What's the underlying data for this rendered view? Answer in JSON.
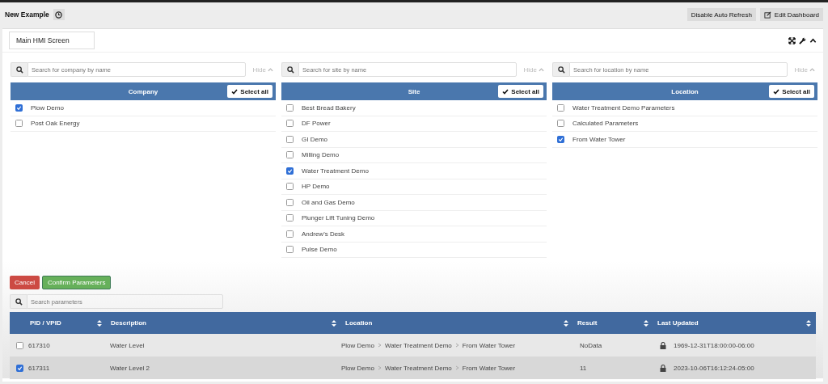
{
  "header": {
    "title": "New Example",
    "buttons": [
      "Disable Auto Refresh",
      "Edit Dashboard"
    ]
  },
  "panel": {
    "title": "Main HMI Screen"
  },
  "selectors": [
    {
      "search_placeholder": "Search for company by name",
      "hide": "Hide",
      "heading": "Company",
      "select_all": "Select all",
      "items": [
        {
          "label": "Plow Demo",
          "checked": true
        },
        {
          "label": "Post Oak Energy",
          "checked": false
        }
      ]
    },
    {
      "search_placeholder": "Search for site by name",
      "hide": "Hide",
      "heading": "Site",
      "select_all": "Select all",
      "items": [
        {
          "label": "Best Bread Bakery",
          "checked": false
        },
        {
          "label": "DF Power",
          "checked": false
        },
        {
          "label": "GI Demo",
          "checked": false
        },
        {
          "label": "Milling Demo",
          "checked": false
        },
        {
          "label": "Water Treatment Demo",
          "checked": true
        },
        {
          "label": "HP Demo",
          "checked": false
        },
        {
          "label": "Oil and Gas Demo",
          "checked": false
        },
        {
          "label": "Plunger Lift Tuning Demo",
          "checked": false
        },
        {
          "label": "Andrew's Desk",
          "checked": false
        },
        {
          "label": "Pulse Demo",
          "checked": false
        }
      ]
    },
    {
      "search_placeholder": "Search for location by name",
      "hide": "Hide",
      "heading": "Location",
      "select_all": "Select all",
      "items": [
        {
          "label": "Water Treatment Demo Parameters",
          "checked": false
        },
        {
          "label": "Calculated Parameters",
          "checked": false
        },
        {
          "label": "From Water Tower",
          "checked": true
        }
      ]
    }
  ],
  "actions": {
    "cancel": "Cancel",
    "confirm": "Confirm Parameters"
  },
  "parameter_search": {
    "placeholder": "Search parameters"
  },
  "table": {
    "columns": [
      "PID / VPID",
      "Description",
      "Location",
      "Result",
      "Last Updated"
    ],
    "rows": [
      {
        "checked": false,
        "pid": "617310",
        "description": "Water Level",
        "location": [
          "Plow Demo",
          "Water Treatment Demo",
          "From Water Tower"
        ],
        "result": "NoData",
        "updated": "1969-12-31T18:00:00-06:00"
      },
      {
        "checked": true,
        "pid": "617311",
        "description": "Water Level 2",
        "location": [
          "Plow Demo",
          "Water Treatment Demo",
          "From Water Tower"
        ],
        "result": "11",
        "updated": "2023-10-06T16:12:24-05:00"
      }
    ]
  }
}
